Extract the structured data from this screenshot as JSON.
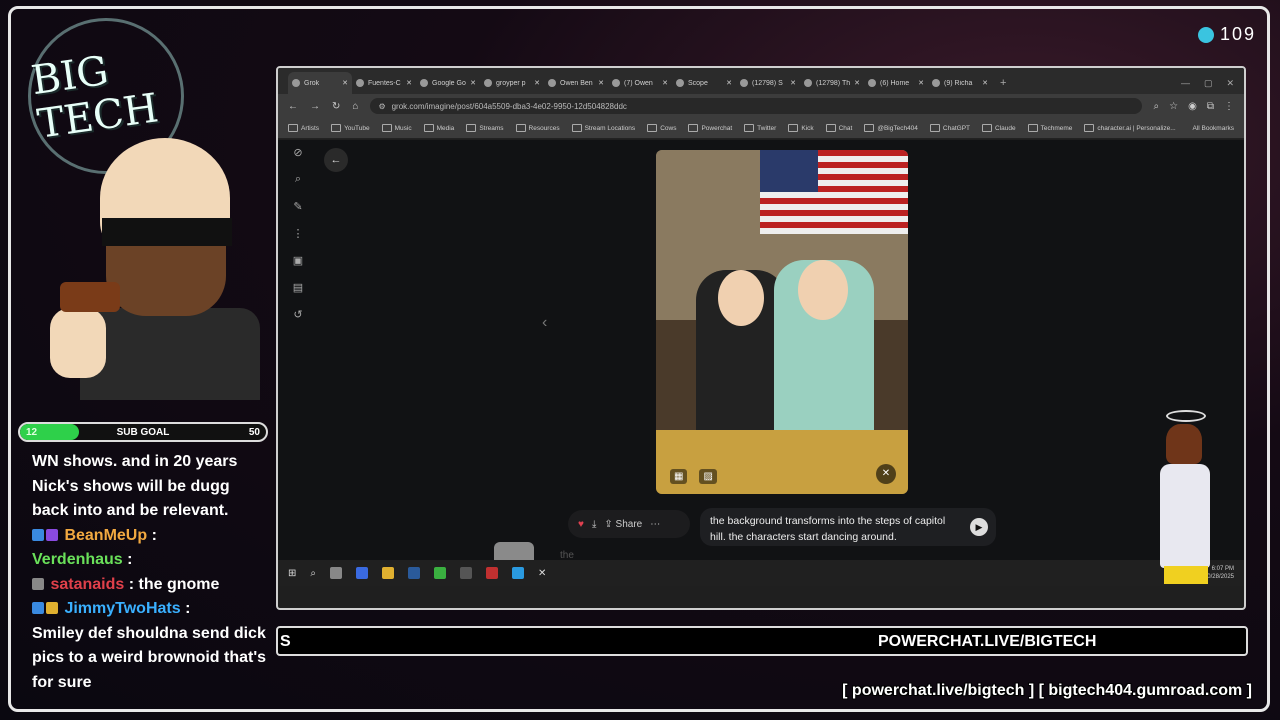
{
  "viewer_count": "109",
  "logo": {
    "line1": "BIG",
    "line2": "TECH"
  },
  "sub_goal": {
    "current": "12",
    "label": "SUB GOAL",
    "max": "50",
    "fraction": 0.24
  },
  "chat": [
    {
      "user": "",
      "text": "WN shows. and in 20 years Nick's shows will be dugg back into and be relevant.",
      "user_color": ""
    },
    {
      "user": "BeanMeUp",
      "text": ":",
      "user_color": "#f2a940"
    },
    {
      "user": "Verdenhaus",
      "text": ":",
      "user_color": "#6ae05a"
    },
    {
      "user": "satanaids",
      "text": ": the gnome",
      "user_color": "#e0404a"
    },
    {
      "user": "JimmyTwoHats",
      "text": ":",
      "user_color": "#3ab0ff"
    },
    {
      "user": "",
      "text": "Smiley def shouldna send dick pics to a weird brownoid that's for sure",
      "user_color": ""
    }
  ],
  "browser": {
    "tabs": [
      {
        "label": "Grok",
        "active": true
      },
      {
        "label": "Fuentes-C",
        "active": false
      },
      {
        "label": "Google Go",
        "active": false
      },
      {
        "label": "groyper p",
        "active": false
      },
      {
        "label": "Owen Ben",
        "active": false
      },
      {
        "label": "(7) Owen",
        "active": false
      },
      {
        "label": "Scope",
        "active": false
      },
      {
        "label": "(12798) S",
        "active": false
      },
      {
        "label": "(12798) Th",
        "active": false
      },
      {
        "label": "(6) Home",
        "active": false
      },
      {
        "label": "(9) Richa",
        "active": false
      }
    ],
    "url": "grok.com/imagine/post/604a5509-dba3-4e02-9950-12d504828ddc",
    "bookmarks": [
      "Artists",
      "YouTube",
      "Music",
      "Media",
      "Streams",
      "Resources",
      "Stream Locations",
      "Cows",
      "Powerchat",
      "Twitter",
      "Kick",
      "Chat",
      "@BigTech404",
      "ChatGPT",
      "Claude",
      "Techmeme",
      "character.ai | Personalize..."
    ],
    "all_bookmarks": "All Bookmarks",
    "share_label": "Share",
    "prompt_text": "the background transforms into the steps of capitol hill. the characters start dancing around.",
    "input_placeholder": "the",
    "clock_time": "6:07 PM",
    "clock_date": "10/28/2025"
  },
  "ticker": {
    "left": "S",
    "main": "POWERCHAT.LIVE/BIGTECH"
  },
  "links": "[ powerchat.live/bigtech ] [ bigtech404.gumroad.com ]"
}
